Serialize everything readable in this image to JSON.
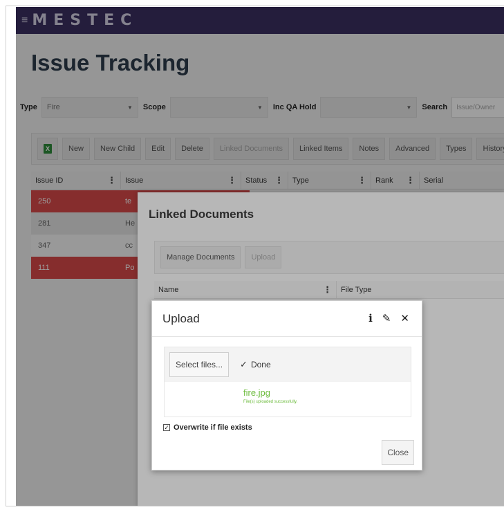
{
  "header": {
    "menu_icon": "menu-icon",
    "brand": "MESTEC"
  },
  "page": {
    "title": "Issue Tracking"
  },
  "filters": {
    "type_label": "Type",
    "type_value": "Fire",
    "scope_label": "Scope",
    "scope_value": "",
    "qa_label": "Inc QA Hold",
    "qa_value": "",
    "search_label": "Search",
    "search_placeholder": "Issue/Owner"
  },
  "toolbar": {
    "items": [
      {
        "label": "New",
        "disabled": false
      },
      {
        "label": "New Child",
        "disabled": false
      },
      {
        "label": "Edit",
        "disabled": false
      },
      {
        "label": "Delete",
        "disabled": false
      },
      {
        "label": "Linked Documents",
        "disabled": true
      },
      {
        "label": "Linked Items",
        "disabled": false
      },
      {
        "label": "Notes",
        "disabled": false
      },
      {
        "label": "Advanced",
        "disabled": false
      },
      {
        "label": "Types",
        "disabled": false
      },
      {
        "label": "History",
        "disabled": false
      }
    ]
  },
  "grid": {
    "columns": [
      "Issue ID",
      "Issue",
      "Status",
      "Type",
      "Rank",
      "Serial"
    ],
    "rows": [
      {
        "id": "250",
        "issue": "te",
        "style": "red"
      },
      {
        "id": "281",
        "issue": "He",
        "style": "grey"
      },
      {
        "id": "347",
        "issue": "cc",
        "style": "white"
      },
      {
        "id": "111",
        "issue": "Po",
        "style": "red"
      }
    ]
  },
  "linked_documents": {
    "title": "Linked Documents",
    "toolbar": {
      "manage": "Manage Documents",
      "upload": "Upload"
    },
    "columns": [
      "Name",
      "File Type"
    ]
  },
  "upload": {
    "title": "Upload",
    "select_files": "Select files...",
    "done": "Done",
    "file_name": "fire.jpg",
    "file_status": "File(s) uploaded successfully.",
    "overwrite_label": "Overwrite if file exists",
    "overwrite_checked": true,
    "close": "Close"
  },
  "colors": {
    "topbar": "#3b2f61",
    "row_highlight": "#d84a4a",
    "success": "#6cbb3c"
  }
}
